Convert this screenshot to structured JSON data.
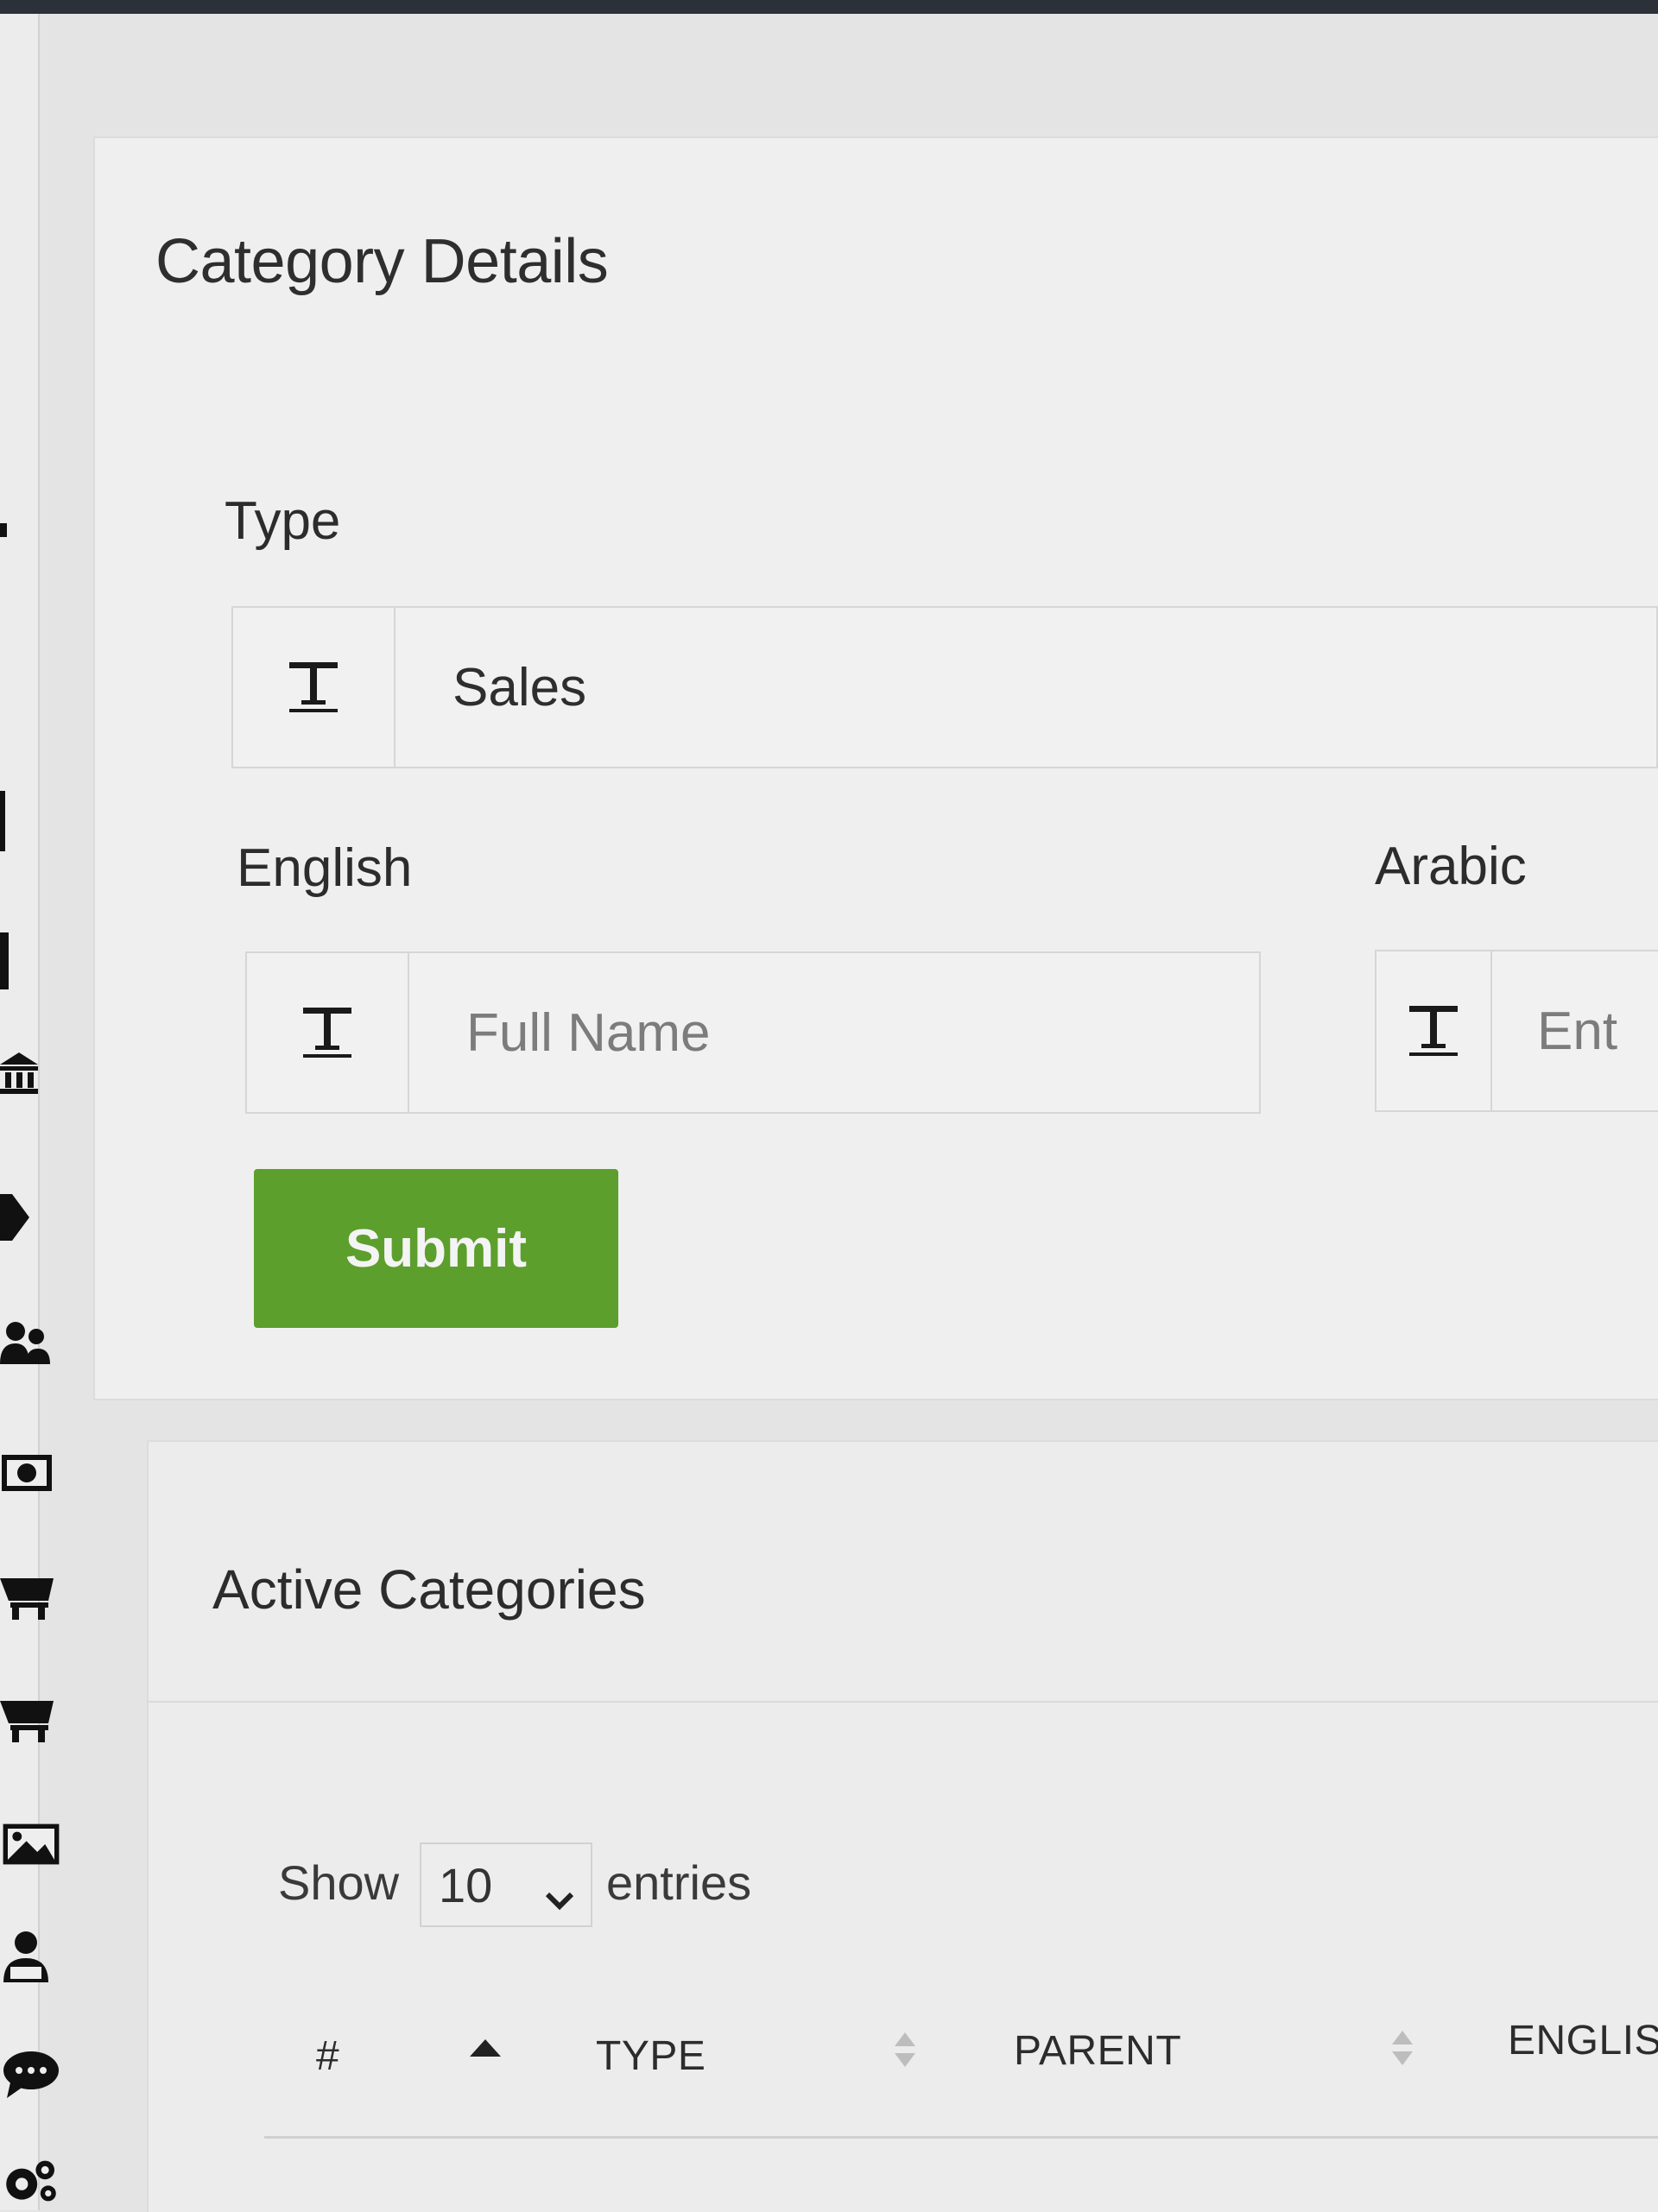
{
  "form": {
    "title": "Category Details",
    "type_label": "Type",
    "type_value": "Sales",
    "english_label": "English",
    "english_placeholder": "Full Name",
    "arabic_label": "Arabic",
    "arabic_placeholder": "Ent",
    "submit_label": "Submit",
    "field_icon": "text-height-icon",
    "submit_color": "#5c9f2c"
  },
  "table": {
    "title": "Active Categories",
    "show_label": "Show",
    "page_size": "10",
    "entries_label": "entries",
    "columns": [
      "#",
      "TYPE",
      "PARENT",
      "ENGLISH"
    ]
  },
  "sidebar": {
    "icons": [
      "bank-icon",
      "tag-icon",
      "users-icon",
      "money-icon",
      "cart-icon",
      "cart-icon",
      "image-icon",
      "user-tie-icon",
      "comment-icon",
      "gears-icon"
    ]
  }
}
